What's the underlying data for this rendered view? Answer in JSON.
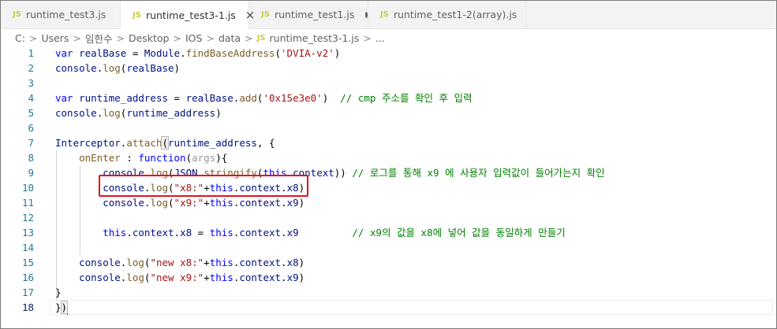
{
  "tabs": [
    {
      "label": "runtime_test3.js",
      "icon": "js-icon",
      "active": false,
      "state": "none"
    },
    {
      "label": "runtime_test3-1.js",
      "icon": "js-icon",
      "active": true,
      "state": "close"
    },
    {
      "label": "runtime_test1.js",
      "icon": "js-icon",
      "active": false,
      "state": "modified"
    },
    {
      "label": "runtime_test1-2(array).js",
      "icon": "js-icon",
      "active": false,
      "state": "modified"
    }
  ],
  "icon_text": {
    "js": "JS",
    "close": "×",
    "sep": ">"
  },
  "breadcrumb": {
    "parts": [
      "C:",
      "Users",
      "임한수",
      "Desktop",
      "IOS",
      "data"
    ],
    "file": "runtime_test3-1.js",
    "tail": "..."
  },
  "editor": {
    "line_numbers": [
      "1",
      "2",
      "3",
      "4",
      "5",
      "6",
      "7",
      "8",
      "9",
      "10",
      "11",
      "12",
      "13",
      "14",
      "15",
      "16",
      "17",
      "18"
    ],
    "current_line": "18",
    "lines": [
      [
        {
          "t": "kw",
          "v": "var"
        },
        {
          "t": "p",
          "v": " "
        },
        {
          "t": "id",
          "v": "realBase"
        },
        {
          "t": "p",
          "v": " = "
        },
        {
          "t": "id",
          "v": "Module"
        },
        {
          "t": "p",
          "v": "."
        },
        {
          "t": "fn",
          "v": "findBaseAddress"
        },
        {
          "t": "p",
          "v": "("
        },
        {
          "t": "str",
          "v": "'DVIA-v2'"
        },
        {
          "t": "p",
          "v": ")"
        }
      ],
      [
        {
          "t": "id",
          "v": "console"
        },
        {
          "t": "p",
          "v": "."
        },
        {
          "t": "fn",
          "v": "log"
        },
        {
          "t": "p",
          "v": "("
        },
        {
          "t": "id",
          "v": "realBase"
        },
        {
          "t": "p",
          "v": ")"
        }
      ],
      [],
      [
        {
          "t": "kw",
          "v": "var"
        },
        {
          "t": "p",
          "v": " "
        },
        {
          "t": "id",
          "v": "runtime_address"
        },
        {
          "t": "p",
          "v": " = "
        },
        {
          "t": "id",
          "v": "realBase"
        },
        {
          "t": "p",
          "v": "."
        },
        {
          "t": "fn",
          "v": "add"
        },
        {
          "t": "p",
          "v": "("
        },
        {
          "t": "str",
          "v": "'0x15e3e0'"
        },
        {
          "t": "p",
          "v": ")  "
        },
        {
          "t": "cm",
          "v": "// cmp 주소를 확인 후 입력"
        }
      ],
      [
        {
          "t": "id",
          "v": "console"
        },
        {
          "t": "p",
          "v": "."
        },
        {
          "t": "fn",
          "v": "log"
        },
        {
          "t": "p",
          "v": "("
        },
        {
          "t": "id",
          "v": "runtime_address"
        },
        {
          "t": "p",
          "v": ")"
        }
      ],
      [],
      [
        {
          "t": "id",
          "v": "Interceptor"
        },
        {
          "t": "p",
          "v": "."
        },
        {
          "t": "fn",
          "v": "attach"
        },
        {
          "t": "hl",
          "v": "("
        },
        {
          "t": "id",
          "v": "runtime_address"
        },
        {
          "t": "p",
          "v": ", {"
        }
      ],
      [
        {
          "t": "p",
          "v": "    "
        },
        {
          "t": "fn",
          "v": "onEnter"
        },
        {
          "t": "p",
          "v": " : "
        },
        {
          "t": "kw",
          "v": "function"
        },
        {
          "t": "p",
          "v": "("
        },
        {
          "t": "arg",
          "v": "args"
        },
        {
          "t": "p",
          "v": "){"
        }
      ],
      [
        {
          "t": "p",
          "v": "        "
        },
        {
          "t": "id",
          "v": "console"
        },
        {
          "t": "p",
          "v": "."
        },
        {
          "t": "fn",
          "v": "log"
        },
        {
          "t": "p",
          "v": "("
        },
        {
          "t": "id",
          "v": "JSON"
        },
        {
          "t": "p",
          "v": "."
        },
        {
          "t": "fn",
          "v": "stringify"
        },
        {
          "t": "p",
          "v": "("
        },
        {
          "t": "kw",
          "v": "this"
        },
        {
          "t": "p",
          "v": "."
        },
        {
          "t": "id",
          "v": "context"
        },
        {
          "t": "p",
          "v": ")) "
        },
        {
          "t": "cm",
          "v": "// 로그를 통해 x9 에 사용자 입력값이 들어가는지 확인"
        }
      ],
      [
        {
          "t": "p",
          "v": "        "
        },
        {
          "t": "id",
          "v": "console"
        },
        {
          "t": "p",
          "v": "."
        },
        {
          "t": "fn",
          "v": "log"
        },
        {
          "t": "p",
          "v": "("
        },
        {
          "t": "str",
          "v": "\"x8:\""
        },
        {
          "t": "p",
          "v": "+"
        },
        {
          "t": "kw",
          "v": "this"
        },
        {
          "t": "p",
          "v": "."
        },
        {
          "t": "id",
          "v": "context"
        },
        {
          "t": "p",
          "v": "."
        },
        {
          "t": "id",
          "v": "x8"
        },
        {
          "t": "p",
          "v": ")"
        }
      ],
      [
        {
          "t": "p",
          "v": "        "
        },
        {
          "t": "id",
          "v": "console"
        },
        {
          "t": "p",
          "v": "."
        },
        {
          "t": "fn",
          "v": "log"
        },
        {
          "t": "p",
          "v": "("
        },
        {
          "t": "str",
          "v": "\"x9:\""
        },
        {
          "t": "p",
          "v": "+"
        },
        {
          "t": "kw",
          "v": "this"
        },
        {
          "t": "p",
          "v": "."
        },
        {
          "t": "id",
          "v": "context"
        },
        {
          "t": "p",
          "v": "."
        },
        {
          "t": "id",
          "v": "x9"
        },
        {
          "t": "p",
          "v": ")"
        }
      ],
      [],
      [
        {
          "t": "p",
          "v": "        "
        },
        {
          "t": "kw",
          "v": "this"
        },
        {
          "t": "p",
          "v": "."
        },
        {
          "t": "id",
          "v": "context"
        },
        {
          "t": "p",
          "v": "."
        },
        {
          "t": "id",
          "v": "x8"
        },
        {
          "t": "p",
          "v": " = "
        },
        {
          "t": "kw",
          "v": "this"
        },
        {
          "t": "p",
          "v": "."
        },
        {
          "t": "id",
          "v": "context"
        },
        {
          "t": "p",
          "v": "."
        },
        {
          "t": "id",
          "v": "x9"
        },
        {
          "t": "p",
          "v": "         "
        },
        {
          "t": "cm",
          "v": "// x9의 값을 x8에 넣어 값을 동일하게 만들기"
        }
      ],
      [],
      [
        {
          "t": "p",
          "v": "    "
        },
        {
          "t": "id",
          "v": "console"
        },
        {
          "t": "p",
          "v": "."
        },
        {
          "t": "fn",
          "v": "log"
        },
        {
          "t": "p",
          "v": "("
        },
        {
          "t": "str",
          "v": "\"new x8:\""
        },
        {
          "t": "p",
          "v": "+"
        },
        {
          "t": "kw",
          "v": "this"
        },
        {
          "t": "p",
          "v": "."
        },
        {
          "t": "id",
          "v": "context"
        },
        {
          "t": "p",
          "v": "."
        },
        {
          "t": "id",
          "v": "x8"
        },
        {
          "t": "p",
          "v": ")"
        }
      ],
      [
        {
          "t": "p",
          "v": "    "
        },
        {
          "t": "id",
          "v": "console"
        },
        {
          "t": "p",
          "v": "."
        },
        {
          "t": "fn",
          "v": "log"
        },
        {
          "t": "p",
          "v": "("
        },
        {
          "t": "str",
          "v": "\"new x9:\""
        },
        {
          "t": "p",
          "v": "+"
        },
        {
          "t": "kw",
          "v": "this"
        },
        {
          "t": "p",
          "v": "."
        },
        {
          "t": "id",
          "v": "context"
        },
        {
          "t": "p",
          "v": "."
        },
        {
          "t": "id",
          "v": "x9"
        },
        {
          "t": "p",
          "v": ")"
        }
      ],
      [
        {
          "t": "p",
          "v": "}"
        }
      ],
      [
        {
          "t": "p",
          "v": "}"
        },
        {
          "t": "hl",
          "v": ")"
        },
        {
          "t": "cursor",
          "v": ""
        }
      ]
    ]
  },
  "colors": {
    "keyword": "#0000ff",
    "identifier": "#001080",
    "function": "#795e26",
    "string": "#a31515",
    "comment": "#008000",
    "line_number": "#237893",
    "annotation_box": "#e0131f"
  }
}
